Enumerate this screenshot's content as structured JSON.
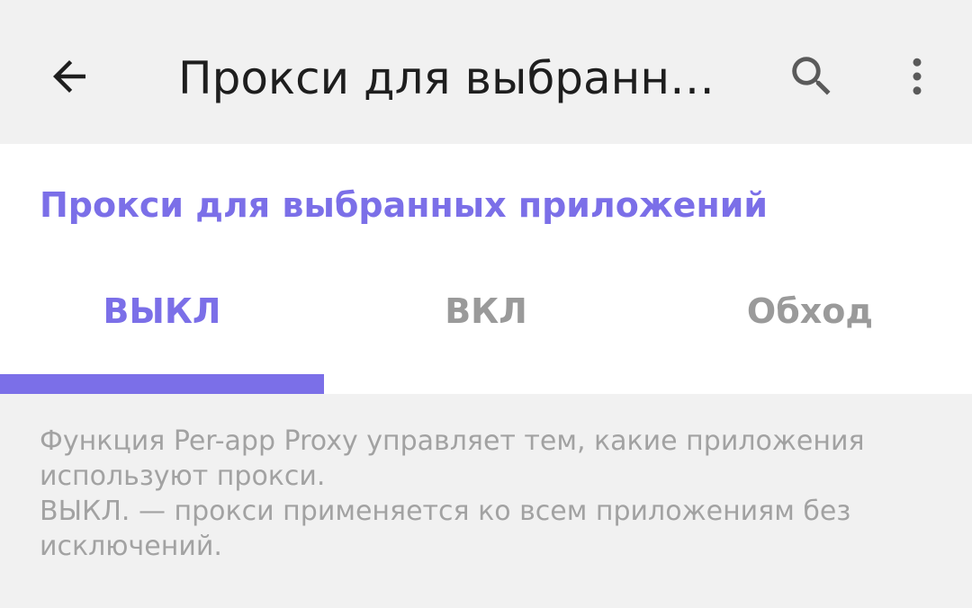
{
  "appbar": {
    "title": "Прокси для выбранн…",
    "back_icon": "arrow-left-icon",
    "search_icon": "search-icon",
    "more_icon": "more-vert-icon"
  },
  "section": {
    "title": "Прокси для выбранных приложений"
  },
  "tabs": [
    {
      "label": "ВЫКЛ",
      "active": true
    },
    {
      "label": "ВКЛ",
      "active": false
    },
    {
      "label": "Обход",
      "active": false
    }
  ],
  "description": {
    "line1": "Функция Per-app Proxy управляет тем, какие приложения используют прокси.",
    "line2": "ВЫКЛ. — прокси применяется ко всем приложениям без исключений."
  },
  "colors": {
    "accent": "#7b6fe8",
    "inactive_tab": "#9a9a9a",
    "description_text": "#a2a2a2",
    "background": "#f1f1f1",
    "card": "#ffffff"
  }
}
